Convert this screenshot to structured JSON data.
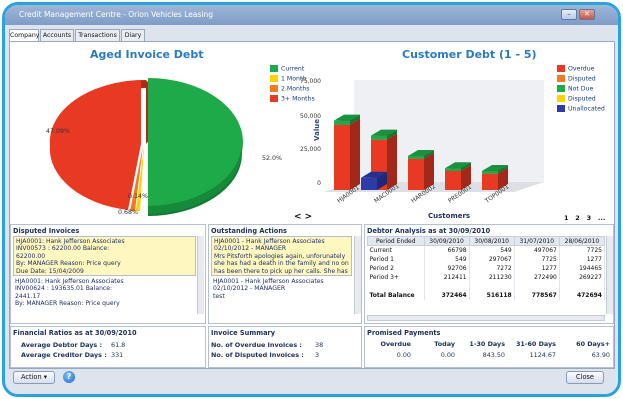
{
  "window": {
    "title": "Credit Management Centre - Orion Vehicles Leasing"
  },
  "tabs": [
    "Company",
    "Accounts",
    "Transactions",
    "Diary"
  ],
  "aged_chart_title": "Aged Invoice Debt",
  "customer_chart_title": "Customer Debt (1 - 5)",
  "pager": {
    "arrows": "< >",
    "pages": "1   2   3   ..."
  },
  "chart_data": [
    {
      "type": "pie",
      "title": "Aged Invoice Debt",
      "categories": [
        "Current",
        "1 Month",
        "2 Months",
        "3+ Months"
      ],
      "values": [
        52.09,
        0.14,
        0.68,
        47.09
      ],
      "slice_labels": [
        "47.09%",
        "52.0%",
        "0.14%",
        "0.68%"
      ],
      "colors": [
        "#1faa4a",
        "#ffd200",
        "#f47a20",
        "#e83a23"
      ],
      "legend": "right"
    },
    {
      "type": "bar",
      "title": "Customer Debt (1 - 5)",
      "xlabel": "Customers",
      "ylabel": "Value",
      "ylim": [
        0,
        75000
      ],
      "yticks": [
        "75,000",
        "50,000",
        "25,000",
        "0"
      ],
      "categories": [
        "HJA0001",
        "MAC0001",
        "HAR0002",
        "PRE0001",
        "TOP0001"
      ],
      "legend": "right",
      "series": [
        {
          "name": "Overdue",
          "color": "#e83a23",
          "values": [
            48000,
            37000,
            23000,
            14000,
            12000
          ]
        },
        {
          "name": "Disputed",
          "color": "#f47a20",
          "values": [
            0,
            0,
            0,
            0,
            0
          ]
        },
        {
          "name": "Not Due",
          "color": "#1faa4a",
          "values": [
            3000,
            3000,
            2000,
            2000,
            2000
          ]
        },
        {
          "name": "Disputed",
          "color": "#ffd200",
          "values": [
            0,
            0,
            0,
            0,
            0
          ]
        },
        {
          "name": "Unallocated",
          "color": "#2d3aa8",
          "values": [
            0,
            9000,
            0,
            0,
            0
          ]
        }
      ]
    }
  ],
  "disputed": {
    "title": "Disputed Invoices",
    "entries": [
      {
        "l1": "HJA0001: Hank Jefferson Associates",
        "l2": "INV00573          :  62200.00 Balance:",
        "l3": "62200.00",
        "l4": "By: MANAGER   Reason: Price query",
        "l5": "Due Date: 15/04/2009"
      },
      {
        "l1": "HJA0001: Hank Jefferson Associates",
        "l2": "INV00624          :  193635.01 Balance:",
        "l3": "2441.17",
        "l4": "By: MANAGER   Reason: Price query",
        "l5": ""
      }
    ]
  },
  "actions": {
    "title": "Outstanding Actions",
    "lines": [
      "HJA0001 - Hank Jefferson Associates",
      "02/10/2012 - MANAGER",
      "Mrs Pitsforth apologies again, unforunately",
      "she has had a death in the family and no on",
      "has been there to pick up her calls. She has"
    ],
    "lines2": [
      "HJA0001 - Hank Jefferson Associates",
      "02/10/2012 - MANAGER",
      "test"
    ]
  },
  "debtor": {
    "title": "Debtor Analysis as at 30/09/2010",
    "headers": [
      "Period Ended",
      "30/09/2010",
      "30/08/2010",
      "31/07/2010",
      "28/06/2010"
    ],
    "rows": [
      [
        "Current",
        "66798",
        "549",
        "497067",
        "7725"
      ],
      [
        "Period 1",
        "549",
        "297067",
        "7725",
        "1277"
      ],
      [
        "Period 2",
        "92706",
        "7272",
        "1277",
        "194465"
      ],
      [
        "Period 3+",
        "212411",
        "211230",
        "272490",
        "269227"
      ],
      [
        "",
        "",
        "",
        "",
        ""
      ],
      [
        "Total Balance",
        "372464",
        "516118",
        "778567",
        "472694"
      ]
    ]
  },
  "financial": {
    "title": "Financial Ratios as at 30/09/2010",
    "avg_debtor_label": "Average Debtor Days :",
    "avg_debtor_value": "61.8",
    "avg_creditor_label": "Average Creditor Days :",
    "avg_creditor_value": "331"
  },
  "invoice_summary": {
    "title": "Invoice Summary",
    "overdue_label": "No. of Overdue Invoices :",
    "overdue_value": "38",
    "disputed_label": "No. of Disputed Invoices :",
    "disputed_value": "3"
  },
  "promised": {
    "title": "Promised Payments",
    "headers": [
      "Overdue",
      "Today",
      "1-30 Days",
      "31-60 Days",
      "60 Days+"
    ],
    "values": [
      "0.00",
      "0.00",
      "843.50",
      "1124.67",
      "63.90"
    ]
  },
  "footer": {
    "action_label": "Action",
    "close_label": "Close",
    "help_glyph": "?"
  }
}
